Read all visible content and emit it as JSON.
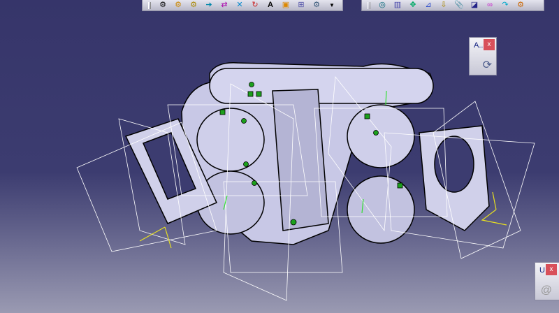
{
  "toolbars": [
    {
      "name": "toolbar-1",
      "icons": [
        "catalog-gear-icon",
        "product-gear-icon",
        "component-gear-icon",
        "insert-arrow-icon",
        "replace-icon",
        "constraint-icon",
        "reorder-icon",
        "text-annotation-icon",
        "save-icon",
        "manage-representation-icon",
        "gear-options-icon"
      ],
      "has_overflow": true
    },
    {
      "name": "toolbar-2",
      "icons": [
        "snap-icon",
        "explode-icon",
        "manipulate-icon",
        "measure-icon",
        "smart-move-icon",
        "clash-icon",
        "section-icon",
        "flexible-icon",
        "reorder-arrow-icon",
        "gear-settings-icon"
      ],
      "has_overflow": false
    }
  ],
  "panels": [
    {
      "title": "A..",
      "close": "x",
      "icon": "update-icon"
    },
    {
      "title": "U..",
      "close": "x",
      "icon": "spiral-icon"
    }
  ],
  "colors": {
    "background_top": "#36356a",
    "part_fill": "#c8c8e6",
    "constraint_green": "#1ca01c",
    "axis_yellow": "#e8e020"
  }
}
